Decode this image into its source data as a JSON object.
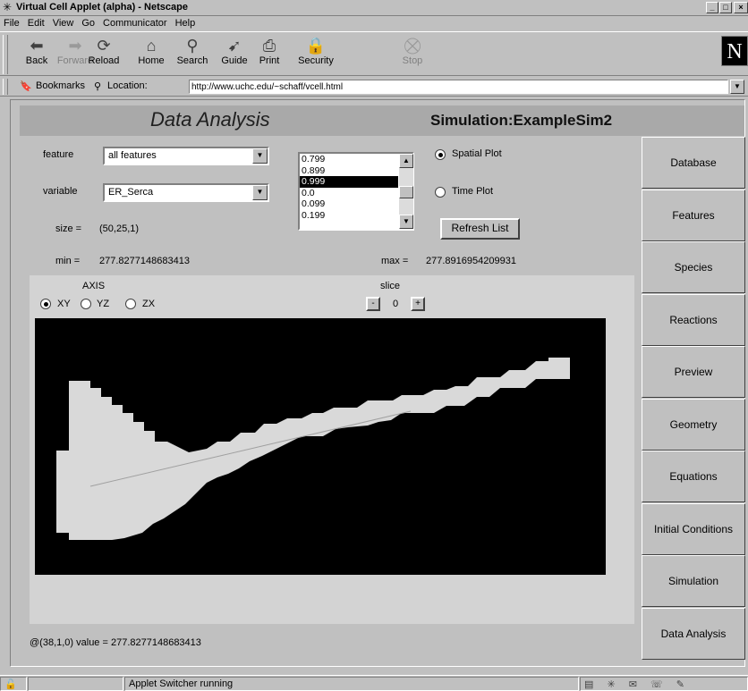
{
  "window": {
    "title": "Virtual Cell Applet (alpha) - Netscape"
  },
  "menu": [
    "File",
    "Edit",
    "View",
    "Go",
    "Communicator",
    "Help"
  ],
  "toolbar": [
    {
      "label": "Back",
      "icon": "back-arrow-icon",
      "enabled": true
    },
    {
      "label": "Forward",
      "icon": "forward-arrow-icon",
      "enabled": false
    },
    {
      "label": "Reload",
      "icon": "reload-icon",
      "enabled": true
    },
    {
      "label": "Home",
      "icon": "home-icon",
      "enabled": true
    },
    {
      "label": "Search",
      "icon": "search-icon",
      "enabled": true
    },
    {
      "label": "Guide",
      "icon": "guide-icon",
      "enabled": true
    },
    {
      "label": "Print",
      "icon": "print-icon",
      "enabled": true
    },
    {
      "label": "Security",
      "icon": "security-lock-icon",
      "enabled": true
    },
    {
      "label": "Stop",
      "icon": "stop-icon",
      "enabled": false
    }
  ],
  "location": {
    "bookmarks_label": "Bookmarks",
    "location_label": "Location:",
    "url": "http://www.uchc.edu/~schaff/vcell.html"
  },
  "applet": {
    "title": "Data Analysis",
    "simulation": "Simulation:ExampleSim2",
    "feature_label": "feature",
    "feature_value": "all features",
    "variable_label": "variable",
    "variable_value": "ER_Serca",
    "size_label": "size =",
    "size_value": "(50,25,1)",
    "min_label": "min =",
    "min_value": "277.8277148683413",
    "max_label": "max =",
    "max_value": "277.8916954209931",
    "time_list": [
      "0.799",
      "0.899",
      "0.999",
      "0.0",
      "0.099",
      "0.199"
    ],
    "time_selected_index": 2,
    "spatial_plot_label": "Spatial Plot",
    "time_plot_label": "Time Plot",
    "plot_mode": "spatial",
    "refresh_label": "Refresh List",
    "axis_label": "AXIS",
    "axes": [
      "XY",
      "YZ",
      "ZX"
    ],
    "axis_selected": "XY",
    "slice_label": "slice",
    "slice_minus": "-",
    "slice_value": "0",
    "slice_plus": "+",
    "readout": "@(38,1,0)  value = 277.8277148683413"
  },
  "tabs": [
    "Database",
    "Features",
    "Species",
    "Reactions",
    "Preview",
    "Geometry",
    "Equations",
    "Initial Conditions",
    "Simulation",
    "Data Analysis"
  ],
  "status": {
    "text": "Applet Switcher running"
  }
}
